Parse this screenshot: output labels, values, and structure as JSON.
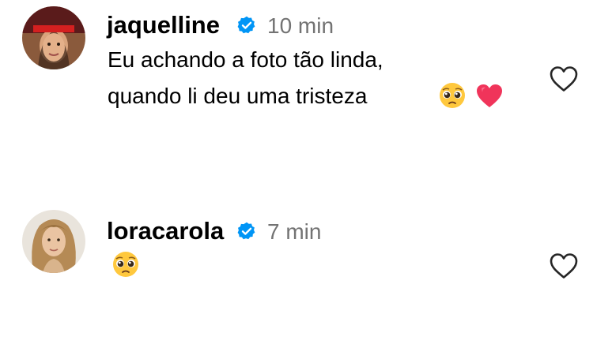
{
  "comments": [
    {
      "username": "jaquelline",
      "verified": true,
      "time": "10 min",
      "text_lines": [
        "Eu achando a foto tão linda,",
        "quando li deu uma tristeza"
      ],
      "emojis": [
        "pleading-face-emoji",
        "heart-emoji"
      ]
    },
    {
      "username": "loracarola",
      "verified": true,
      "time": "7 min",
      "text_lines": [],
      "emojis": [
        "pleading-face-emoji"
      ]
    }
  ],
  "colors": {
    "verified": "#0095f6",
    "time": "#737373",
    "heart_emoji": "#f0345a",
    "like_outline": "#262626"
  }
}
